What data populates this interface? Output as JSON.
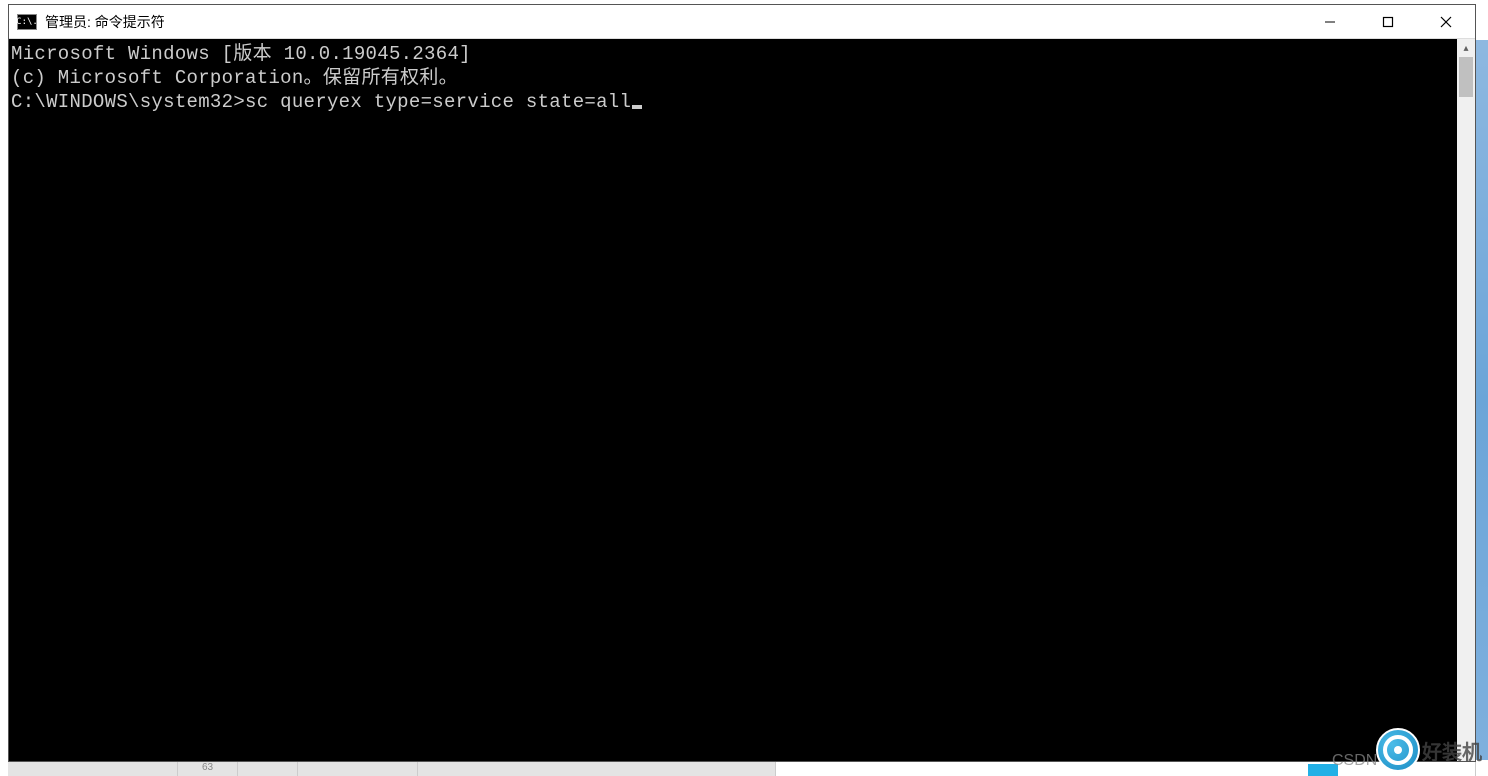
{
  "window": {
    "title": "管理员: 命令提示符",
    "icon_label": "C:\\."
  },
  "console": {
    "line1": "Microsoft Windows [版本 10.0.19045.2364]",
    "line2": "(c) Microsoft Corporation。保留所有权利。",
    "blank": "",
    "prompt": "C:\\WINDOWS\\system32>",
    "command": "sc queryex type=service state=all"
  },
  "watermark": {
    "csdn": "CSDN @",
    "logo_text": "好装机"
  },
  "taskbar": {
    "line_col": "63",
    "misc": ""
  }
}
